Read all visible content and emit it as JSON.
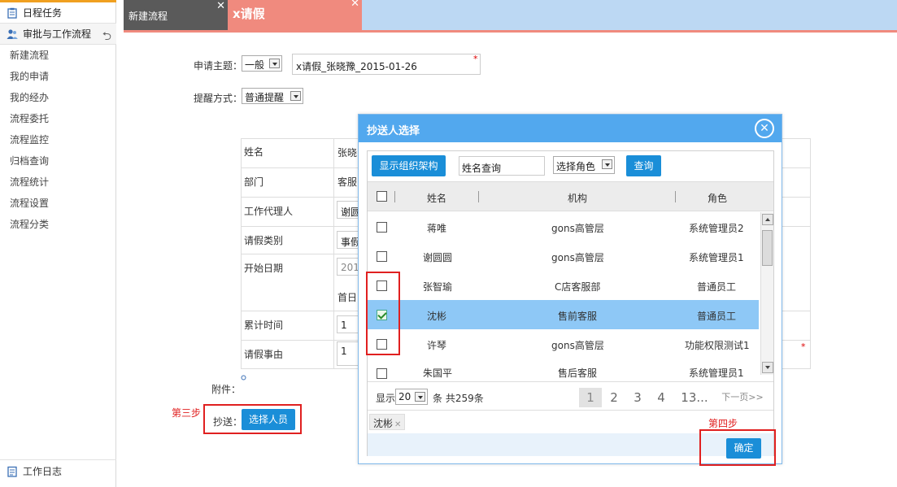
{
  "sidebar": {
    "schedule": "日程任务",
    "approval": "审批与工作流程",
    "items": [
      "新建流程",
      "我的申请",
      "我的经办",
      "流程委托",
      "流程监控",
      "归档查询",
      "流程统计",
      "流程设置",
      "流程分类"
    ],
    "worklog": "工作日志"
  },
  "tabs": [
    {
      "label": "新建流程",
      "close": "✕"
    },
    {
      "label": "x请假",
      "close": "✕"
    }
  ],
  "form": {
    "subject_label": "申请主题：",
    "subject_level": "一般",
    "subject_value": "x请假_张晓豫_2015-01-26",
    "remind_label": "提醒方式：",
    "remind_value": "普通提醒",
    "required_mark": "*",
    "rows": [
      {
        "label": "姓名",
        "value": "张晓"
      },
      {
        "label": "部门",
        "value": "客服"
      },
      {
        "label": "工作代理人",
        "value": "谢圆"
      },
      {
        "label": "请假类别",
        "value": "事假"
      },
      {
        "label": "开始日期",
        "value": "201"
      },
      {
        "label": "",
        "value": "首日"
      },
      {
        "label": "累计时间",
        "value": "1"
      },
      {
        "label": "请假事由",
        "value": "1"
      }
    ],
    "attachment_label": "附件：",
    "cc_label": "抄送：",
    "cc_button": "选择人员",
    "step3": "第三步",
    "step4": "第四步"
  },
  "dialog": {
    "title": "抄送人选择",
    "close": "✕",
    "org_button": "显示组织架构",
    "name_query_placeholder": "姓名查询",
    "role_select": "选择角色",
    "query_button": "查询",
    "columns": {
      "name": "姓名",
      "org": "机构",
      "role": "角色"
    },
    "rows": [
      {
        "name": "蒋唯",
        "org": "gons高管层",
        "role": "系统管理员2",
        "checked": false
      },
      {
        "name": "谢圆圆",
        "org": "gons高管层",
        "role": "系统管理员1",
        "checked": false
      },
      {
        "name": "张智瑜",
        "org": "C店客服部",
        "role": "普通员工",
        "checked": false
      },
      {
        "name": "沈彬",
        "org": "售前客服",
        "role": "普通员工",
        "checked": true
      },
      {
        "name": "许琴",
        "org": "gons高管层",
        "role": "功能权限测试1",
        "checked": false
      },
      {
        "name": "朱国平",
        "org": "售后客服",
        "role": "系统管理员1",
        "checked": false
      }
    ],
    "pager": {
      "show_label": "显示",
      "page_size": "20",
      "total_text": "条 共259条",
      "pages": [
        "1",
        "2",
        "3",
        "4",
        "13..."
      ],
      "next": "下一页>>"
    },
    "selected_chip": "沈彬",
    "chip_remove": "✕",
    "confirm_button": "确定"
  },
  "colors": {
    "accent_blue": "#1a8ed8",
    "dialog_header": "#52a8ee",
    "tab_active": "#f08a7e",
    "tab_inactive": "#5a5a5a",
    "annotation_red": "#e02020",
    "selected_row": "#8ec8f6"
  }
}
